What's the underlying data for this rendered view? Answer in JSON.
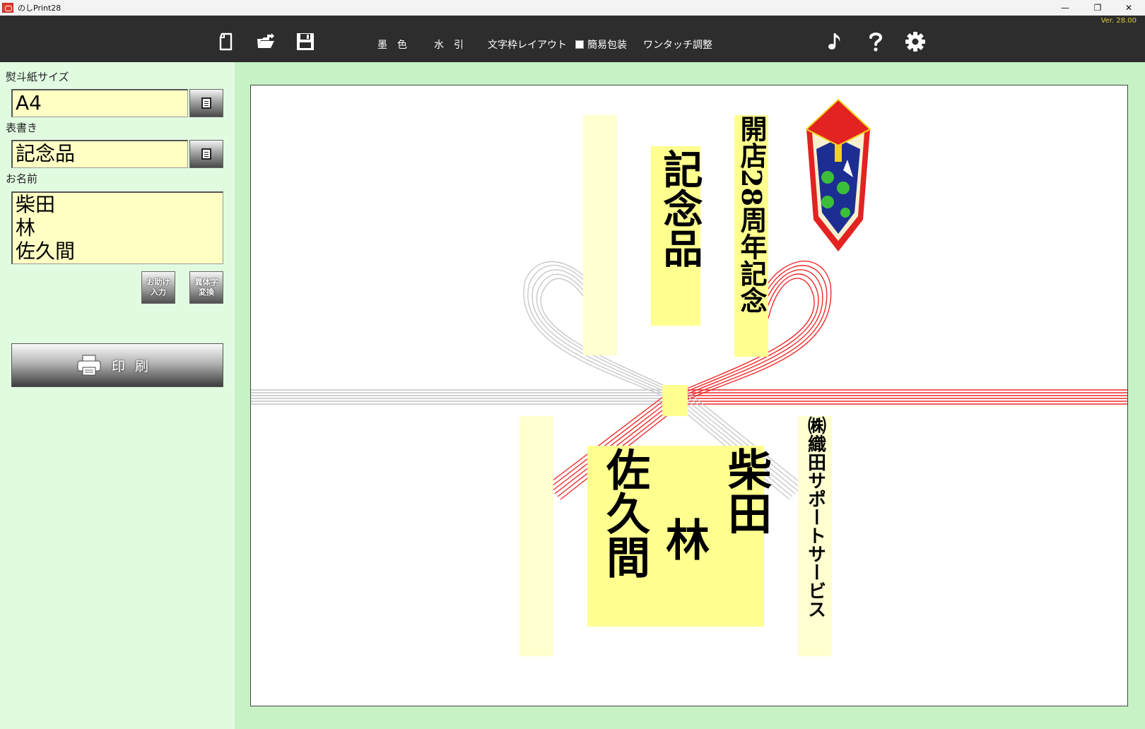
{
  "window": {
    "title": "のしPrint28",
    "version": "Ver. 28.00",
    "minimize": "—",
    "restore": "❐",
    "close": "✕"
  },
  "toolbar": {
    "ink_label": "墨　色",
    "mizuhiki_label": "水　引",
    "layout_label": "文字枠レイアウト",
    "simple_wrap_label": "簡易包装",
    "one_touch_label": "ワンタッチ調整",
    "icons": [
      "new-file-icon",
      "open-folder-icon",
      "save-icon",
      "music-note-icon",
      "help-icon",
      "gear-icon"
    ]
  },
  "left_panel": {
    "paper_size_label": "熨斗紙サイズ",
    "paper_size_value": "A4",
    "omotegaki_label": "表書き",
    "omotegaki_value": "記念品",
    "name_label": "お名前",
    "names": [
      "柴田",
      "林",
      "佐久間"
    ],
    "help_input_line1": "お助け",
    "help_input_line2": "入力",
    "variant_line1": "異体字",
    "variant_line2": "変換",
    "print_label": "印刷"
  },
  "preview": {
    "omotegaki": "記念品",
    "occasion": "開店28周年記念",
    "names_right_to_left": [
      "柴田",
      "林",
      "佐久間"
    ],
    "company": "㈱織田サポートサービス"
  },
  "colors": {
    "toolbar": "#2d2d2d",
    "panel": "#e1fbe1",
    "preview_bg": "#c6f2c6",
    "input": "#ffffc4",
    "highlight": "#ffff8f",
    "mizuhiki_red": "#e82020",
    "mizuhiki_silver": "#bdbdbd",
    "version": "#d8c83a"
  }
}
